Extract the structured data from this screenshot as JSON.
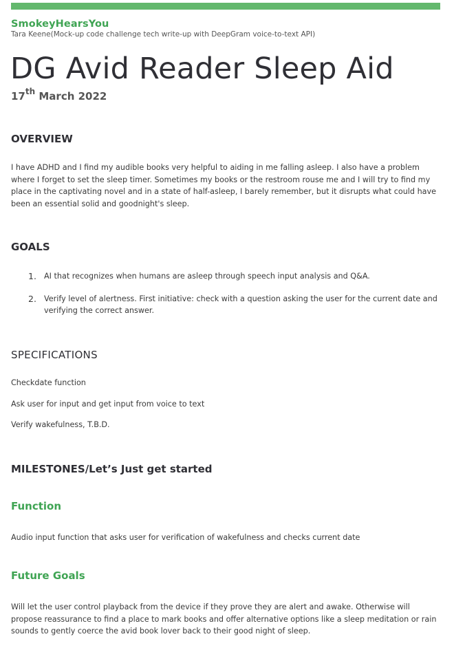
{
  "header": {
    "brand": "SmokeyHearsYou",
    "author": "Tara Keene(Mock-up code challenge tech write-up with DeepGram voice-to-text API)",
    "title": "DG Avid Reader Sleep Aid",
    "date_day": "17",
    "date_suffix": "th",
    "date_rest": " March 2022"
  },
  "overview": {
    "heading": "OVERVIEW",
    "text": "I have ADHD and I find my audible books very helpful to aiding in me falling asleep. I also have a problem where I forget to set the sleep timer. Sometimes my books or the restroom rouse me and I will try to find my place in the captivating novel and in a state of half-asleep, I barely remember, but it disrupts what could have been an essential solid and goodnight's sleep."
  },
  "goals": {
    "heading": "GOALS",
    "items": [
      {
        "num": "1.",
        "text": "AI that recognizes when humans are asleep through speech input analysis and Q&A."
      },
      {
        "num": "2.",
        "text": "Verify level of alertness. First initiative: check with a question asking the user for the current date and verifying the correct answer."
      }
    ]
  },
  "specifications": {
    "heading": "SPECIFICATIONS",
    "items": [
      "Checkdate function",
      "Ask user for input and get input from voice to text",
      "Verify wakefulness, T.B.D."
    ]
  },
  "milestones": {
    "heading": "MILESTONES/Let’s Just get started"
  },
  "function": {
    "heading": "Function",
    "text": "Audio input function that asks user for verification of wakefulness and checks current date"
  },
  "future_goals": {
    "heading": "Future Goals",
    "text": "Will let the user control playback from the device if they prove they are alert and awake. Otherwise will propose reassurance to find a place to mark books and offer alternative options like a sleep meditation or rain sounds to gently coerce the avid book lover back to their good night of sleep."
  },
  "colors": {
    "accent_green": "#3fa453",
    "top_bar": "#63b86d",
    "heading_dark": "#2f2f35"
  }
}
